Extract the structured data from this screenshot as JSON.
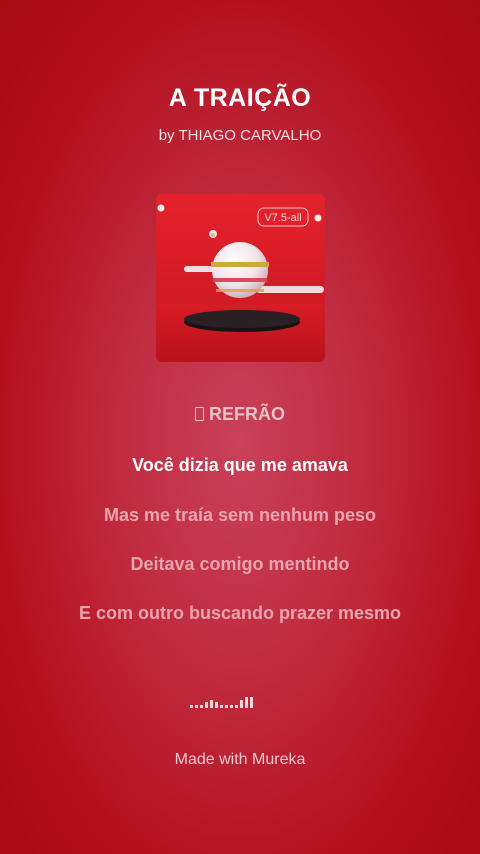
{
  "song": {
    "title": "A TRAIÇÃO",
    "artist_line": "by THIAGO CARVALHO"
  },
  "cover": {
    "badge": "V7.5-all"
  },
  "lyrics": {
    "section_icon": "music-note-icon",
    "section_label": "REFRÃO",
    "lines": [
      "Você dizia que me amava",
      "Mas me traía sem nenhum peso",
      "Deitava comigo mentindo",
      "E com outro buscando prazer mesmo"
    ],
    "active_index": 0
  },
  "waveform": {
    "icon": "audio-waveform-icon",
    "levels": [
      0.2,
      0.2,
      0.2,
      0.45,
      0.6,
      0.45,
      0.2,
      0.2,
      0.2,
      0.2,
      0.6,
      0.8,
      0.8
    ]
  },
  "footer": {
    "made_with": "Made with Mureka"
  },
  "colors": {
    "background": "#b3101c",
    "text_primary": "#ffffff",
    "text_dim": "#e9a4ad"
  }
}
